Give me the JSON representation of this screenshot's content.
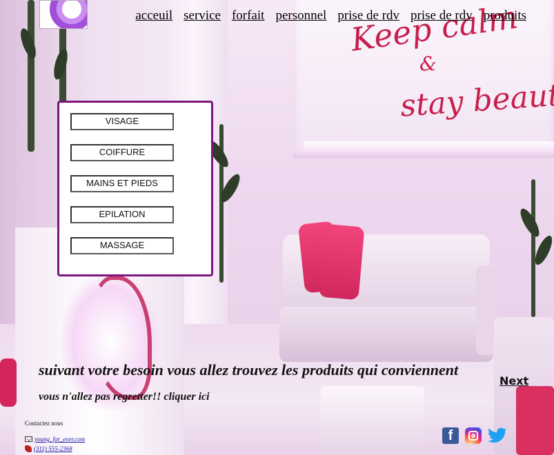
{
  "nav": {
    "items": [
      {
        "label": "acceuil"
      },
      {
        "label": "service"
      },
      {
        "label": "forfait"
      },
      {
        "label": "personnel"
      },
      {
        "label": "prise de rdv "
      },
      {
        "label": "prise de rdv "
      },
      {
        "label": "produits"
      }
    ]
  },
  "background": {
    "slogan_line1": "Keep calm",
    "slogan_line2": "&",
    "slogan_line3": "stay beautiful"
  },
  "services": {
    "buttons": [
      {
        "label": "VISAGE"
      },
      {
        "label": "COIFFURE"
      },
      {
        "label": "MAINS ET PIEDS"
      },
      {
        "label": "EPILATION"
      },
      {
        "label": "MASSAGE"
      }
    ]
  },
  "main": {
    "headline": "suivant votre besoin vous allez trouvez les produits qui conviennent",
    "subline": "vous n'allez pas regretter!! cliquer ici",
    "next_label": "Next"
  },
  "contact": {
    "title": "Contactez nous",
    "email": "young_for_ever.com",
    "phone": "(311) 555-2368"
  },
  "social": {
    "icons": [
      "facebook-icon",
      "instagram-icon",
      "twitter-icon"
    ],
    "facebook_color": "#3b5998",
    "twitter_color": "#1da1f2"
  },
  "colors": {
    "service_border": "#7d137f",
    "accent_pink": "#c71f4c"
  }
}
